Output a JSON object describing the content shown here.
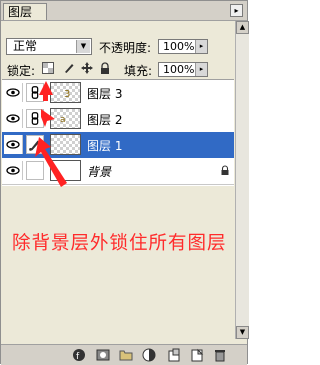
{
  "panel": {
    "tab_label": "图层",
    "menu_glyph": "▸"
  },
  "blend": {
    "mode": "正常",
    "arrow": "▼"
  },
  "opacity": {
    "label": "不透明度:",
    "value": "100%",
    "spin": "▸"
  },
  "lock": {
    "label": "锁定:"
  },
  "fill": {
    "label": "填充:",
    "value": "100%",
    "spin": "▸"
  },
  "layers": [
    {
      "name": "图层 3",
      "selected": false,
      "linked": true
    },
    {
      "name": "图层 2",
      "selected": false,
      "linked": true
    },
    {
      "name": "图层 1",
      "selected": true,
      "brush": true
    },
    {
      "name": "背景",
      "selected": false,
      "locked": true
    }
  ],
  "annotation": {
    "text": "除背景层外锁住所有图层"
  },
  "scrollbar": {
    "up": "▲",
    "down": "▼"
  },
  "colors": {
    "selection": "#316ac5",
    "annotation": "#ff2b2b",
    "panel": "#ece9d8"
  }
}
